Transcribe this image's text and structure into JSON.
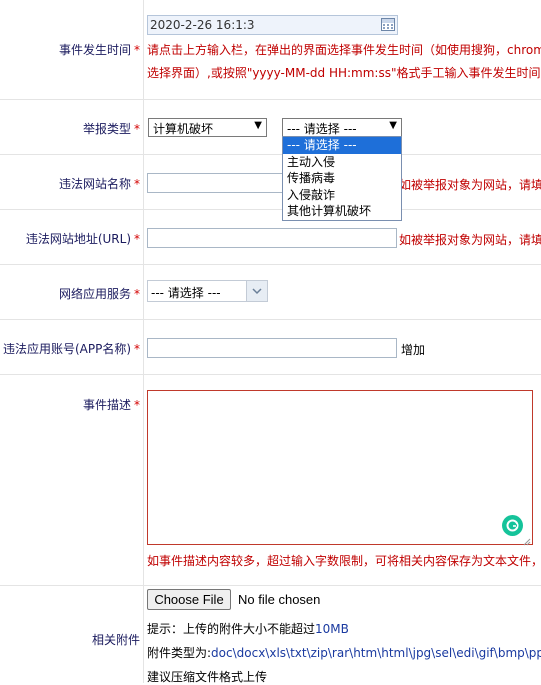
{
  "event_time": {
    "label": "事件发生时间",
    "required_mark": "*",
    "value": "2020-2-26 16:1:3",
    "hint_line1": "请点击上方输入栏，在弹出的界面选择事件发生时间（如使用搜狗，chrome",
    "hint_line2": "选择界面）,或按照\"yyyy-MM-dd HH:mm:ss\"格式手工输入事件发生时间,如"
  },
  "report_type": {
    "label": "举报类型",
    "required_mark": "*",
    "primary_value": "计算机破坏",
    "secondary_value": "--- 请选择 ---",
    "options": [
      "--- 请选择 ---",
      "主动入侵",
      "传播病毒",
      "入侵敲诈",
      "其他计算机破坏"
    ]
  },
  "site_name": {
    "label": "违法网站名称",
    "required_mark": "*",
    "hint": "如被举报对象为网站，请填"
  },
  "site_url": {
    "label": "违法网站地址(URL)",
    "required_mark": "*",
    "hint": "如被举报对象为网站，请填"
  },
  "app_service": {
    "label": "网络应用服务",
    "required_mark": "*",
    "value": "--- 请选择 ---"
  },
  "app_account": {
    "label": "违法应用账号(APP名称)",
    "required_mark": "*",
    "add_label": "增加"
  },
  "description": {
    "label": "事件描述",
    "required_mark": "*",
    "hint": "如事件描述内容较多，超过输入字数限制，可将相关内容保存为文本文件，"
  },
  "attachment": {
    "label": "相关附件",
    "choose_label": "Choose File",
    "no_file": "No file chosen",
    "tip_prefix": "提示：上传的附件大小不能超过",
    "tip_size": "10MB",
    "types_prefix": "附件类型为:",
    "types": "doc\\docx\\xls\\txt\\zip\\rar\\htm\\html\\jpg\\sel\\edi\\gif\\bmp\\ppt",
    "compress_tip": "建议压缩文件格式上传"
  },
  "colors": {
    "hint_red": "#c00000",
    "label_navy": "#1b1b5e",
    "link_blue": "#1a3aa0",
    "grammarly": "#15c39a"
  }
}
